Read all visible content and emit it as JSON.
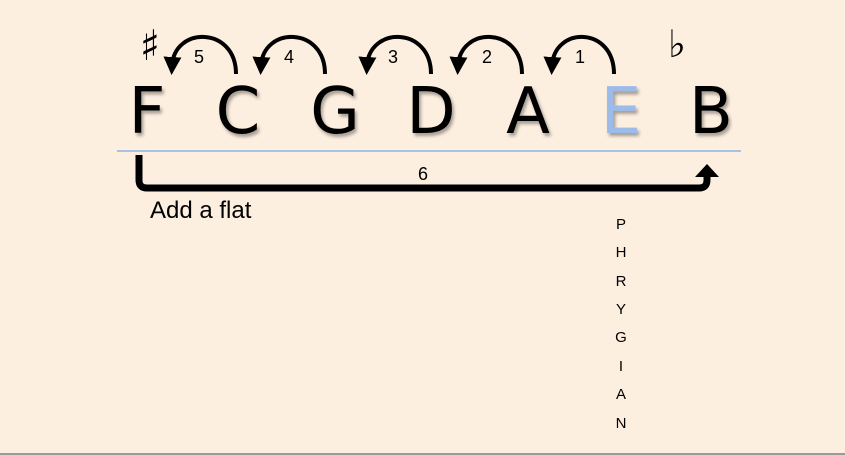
{
  "notes": [
    {
      "letter": "F",
      "highlight": false
    },
    {
      "letter": "C",
      "highlight": false
    },
    {
      "letter": "G",
      "highlight": false
    },
    {
      "letter": "D",
      "highlight": false
    },
    {
      "letter": "A",
      "highlight": false
    },
    {
      "letter": "E",
      "highlight": true
    },
    {
      "letter": "B",
      "highlight": false
    }
  ],
  "sharp_symbol": "♯",
  "flat_symbol": "♭",
  "step_labels": [
    "5",
    "4",
    "3",
    "2",
    "1"
  ],
  "long_arrow_label": "6",
  "caption": "Add a flat",
  "vertical_word": [
    "P",
    "H",
    "R",
    "Y",
    "G",
    "I",
    "A",
    "N"
  ],
  "colors": {
    "background": "#fdefe0",
    "text": "#000000",
    "highlight": "#9dbbe8",
    "rule": "#8fb2e6"
  }
}
